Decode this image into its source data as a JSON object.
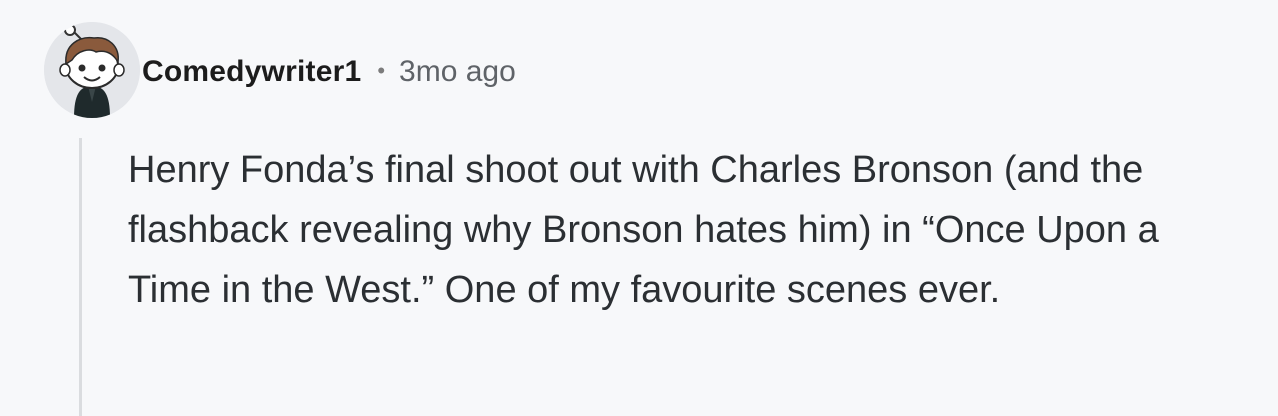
{
  "comment": {
    "author": "Comedywriter1",
    "separator": "•",
    "timestamp": "3mo ago",
    "avatar_icon": "snoo-avatar-icon",
    "body": "Henry Fonda’s final shoot out with Charles Bronson (and the flashback revealing why Bronson hates him) in “Once Upon a Time in the West.” One of my favourite scenes ever."
  },
  "colors": {
    "background": "#f7f8fa",
    "username": "#1c1c1c",
    "timestamp": "#5f6368",
    "body_text": "#2b2f33",
    "thread_line": "#dadcdf"
  }
}
